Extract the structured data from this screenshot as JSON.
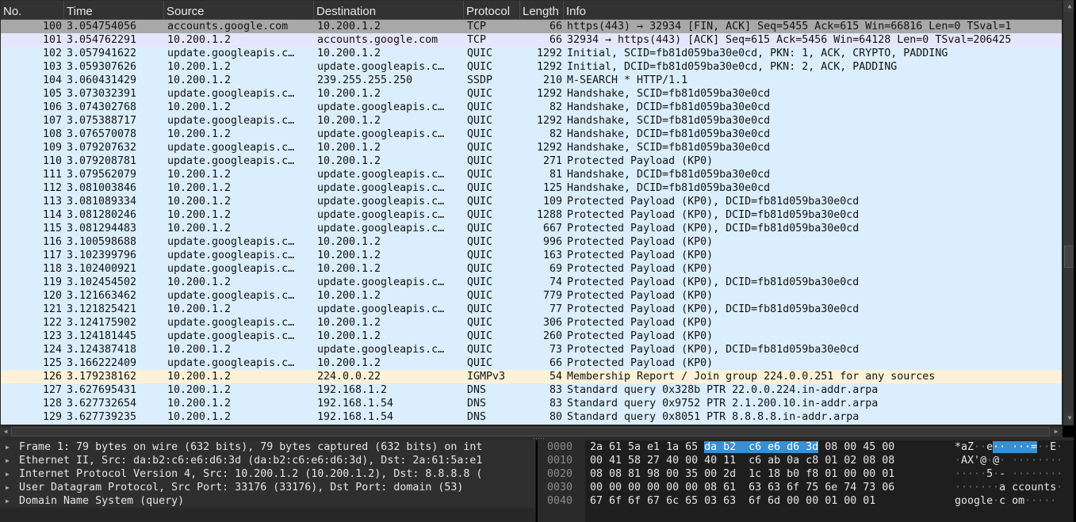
{
  "colors": {
    "row_default": "#dbeefd",
    "row_tcp_selected": "#a8a8a8",
    "row_tcp": "#e7e5fc",
    "row_igmp": "#fdf2d8",
    "header_bg": "#323232",
    "hex_highlight": "#3a8fd1"
  },
  "packet_list": {
    "columns": [
      "No.",
      "Time",
      "Source",
      "Destination",
      "Protocol",
      "Length",
      "Info"
    ],
    "rows": [
      {
        "no": "100",
        "time": "3.054754056",
        "src": "accounts.google.com",
        "dst": "10.200.1.2",
        "proto": "TCP",
        "len": "66",
        "info": "https(443) → 32934 [FIN, ACK] Seq=5455 Ack=615 Win=66816 Len=0 TSval=1",
        "style": "selected"
      },
      {
        "no": "101",
        "time": "3.054762291",
        "src": "10.200.1.2",
        "dst": "accounts.google.com",
        "proto": "TCP",
        "len": "66",
        "info": "32934 → https(443) [ACK] Seq=615 Ack=5456 Win=64128 Len=0 TSval=206425",
        "style": "tcp"
      },
      {
        "no": "102",
        "time": "3.057941622",
        "src": "update.googleapis.c…",
        "dst": "10.200.1.2",
        "proto": "QUIC",
        "len": "1292",
        "info": "Initial, SCID=fb81d059ba30e0cd, PKN: 1, ACK, CRYPTO, PADDING",
        "style": "default"
      },
      {
        "no": "103",
        "time": "3.059307626",
        "src": "10.200.1.2",
        "dst": "update.googleapis.c…",
        "proto": "QUIC",
        "len": "1292",
        "info": "Initial, DCID=fb81d059ba30e0cd, PKN: 2, ACK, PADDING",
        "style": "default"
      },
      {
        "no": "104",
        "time": "3.060431429",
        "src": "10.200.1.2",
        "dst": "239.255.255.250",
        "proto": "SSDP",
        "len": "210",
        "info": "M-SEARCH * HTTP/1.1",
        "style": "default"
      },
      {
        "no": "105",
        "time": "3.073032391",
        "src": "update.googleapis.c…",
        "dst": "10.200.1.2",
        "proto": "QUIC",
        "len": "1292",
        "info": "Handshake, SCID=fb81d059ba30e0cd",
        "style": "default"
      },
      {
        "no": "106",
        "time": "3.074302768",
        "src": "10.200.1.2",
        "dst": "update.googleapis.c…",
        "proto": "QUIC",
        "len": "82",
        "info": "Handshake, DCID=fb81d059ba30e0cd",
        "style": "default"
      },
      {
        "no": "107",
        "time": "3.075388717",
        "src": "update.googleapis.c…",
        "dst": "10.200.1.2",
        "proto": "QUIC",
        "len": "1292",
        "info": "Handshake, SCID=fb81d059ba30e0cd",
        "style": "default"
      },
      {
        "no": "108",
        "time": "3.076570078",
        "src": "10.200.1.2",
        "dst": "update.googleapis.c…",
        "proto": "QUIC",
        "len": "82",
        "info": "Handshake, DCID=fb81d059ba30e0cd",
        "style": "default"
      },
      {
        "no": "109",
        "time": "3.079207632",
        "src": "update.googleapis.c…",
        "dst": "10.200.1.2",
        "proto": "QUIC",
        "len": "1292",
        "info": "Handshake, SCID=fb81d059ba30e0cd",
        "style": "default"
      },
      {
        "no": "110",
        "time": "3.079208781",
        "src": "update.googleapis.c…",
        "dst": "10.200.1.2",
        "proto": "QUIC",
        "len": "271",
        "info": "Protected Payload (KP0)",
        "style": "default"
      },
      {
        "no": "111",
        "time": "3.079562079",
        "src": "10.200.1.2",
        "dst": "update.googleapis.c…",
        "proto": "QUIC",
        "len": "81",
        "info": "Handshake, DCID=fb81d059ba30e0cd",
        "style": "default"
      },
      {
        "no": "112",
        "time": "3.081003846",
        "src": "10.200.1.2",
        "dst": "update.googleapis.c…",
        "proto": "QUIC",
        "len": "125",
        "info": "Handshake, DCID=fb81d059ba30e0cd",
        "style": "default"
      },
      {
        "no": "113",
        "time": "3.081089334",
        "src": "10.200.1.2",
        "dst": "update.googleapis.c…",
        "proto": "QUIC",
        "len": "109",
        "info": "Protected Payload (KP0), DCID=fb81d059ba30e0cd",
        "style": "default"
      },
      {
        "no": "114",
        "time": "3.081280246",
        "src": "10.200.1.2",
        "dst": "update.googleapis.c…",
        "proto": "QUIC",
        "len": "1288",
        "info": "Protected Payload (KP0), DCID=fb81d059ba30e0cd",
        "style": "default"
      },
      {
        "no": "115",
        "time": "3.081294483",
        "src": "10.200.1.2",
        "dst": "update.googleapis.c…",
        "proto": "QUIC",
        "len": "667",
        "info": "Protected Payload (KP0), DCID=fb81d059ba30e0cd",
        "style": "default"
      },
      {
        "no": "116",
        "time": "3.100598688",
        "src": "update.googleapis.c…",
        "dst": "10.200.1.2",
        "proto": "QUIC",
        "len": "996",
        "info": "Protected Payload (KP0)",
        "style": "default"
      },
      {
        "no": "117",
        "time": "3.102399796",
        "src": "update.googleapis.c…",
        "dst": "10.200.1.2",
        "proto": "QUIC",
        "len": "163",
        "info": "Protected Payload (KP0)",
        "style": "default"
      },
      {
        "no": "118",
        "time": "3.102400921",
        "src": "update.googleapis.c…",
        "dst": "10.200.1.2",
        "proto": "QUIC",
        "len": "69",
        "info": "Protected Payload (KP0)",
        "style": "default"
      },
      {
        "no": "119",
        "time": "3.102454502",
        "src": "10.200.1.2",
        "dst": "update.googleapis.c…",
        "proto": "QUIC",
        "len": "74",
        "info": "Protected Payload (KP0), DCID=fb81d059ba30e0cd",
        "style": "default"
      },
      {
        "no": "120",
        "time": "3.121663462",
        "src": "update.googleapis.c…",
        "dst": "10.200.1.2",
        "proto": "QUIC",
        "len": "779",
        "info": "Protected Payload (KP0)",
        "style": "default"
      },
      {
        "no": "121",
        "time": "3.121825421",
        "src": "10.200.1.2",
        "dst": "update.googleapis.c…",
        "proto": "QUIC",
        "len": "77",
        "info": "Protected Payload (KP0), DCID=fb81d059ba30e0cd",
        "style": "default"
      },
      {
        "no": "122",
        "time": "3.124175902",
        "src": "update.googleapis.c…",
        "dst": "10.200.1.2",
        "proto": "QUIC",
        "len": "306",
        "info": "Protected Payload (KP0)",
        "style": "default"
      },
      {
        "no": "123",
        "time": "3.124181445",
        "src": "update.googleapis.c…",
        "dst": "10.200.1.2",
        "proto": "QUIC",
        "len": "260",
        "info": "Protected Payload (KP0)",
        "style": "default"
      },
      {
        "no": "124",
        "time": "3.124387418",
        "src": "10.200.1.2",
        "dst": "update.googleapis.c…",
        "proto": "QUIC",
        "len": "73",
        "info": "Protected Payload (KP0), DCID=fb81d059ba30e0cd",
        "style": "default"
      },
      {
        "no": "125",
        "time": "3.166222409",
        "src": "update.googleapis.c…",
        "dst": "10.200.1.2",
        "proto": "QUIC",
        "len": "66",
        "info": "Protected Payload (KP0)",
        "style": "default"
      },
      {
        "no": "126",
        "time": "3.179238162",
        "src": "10.200.1.2",
        "dst": "224.0.0.22",
        "proto": "IGMPv3",
        "len": "54",
        "info": "Membership Report / Join group 224.0.0.251 for any sources",
        "style": "igmp"
      },
      {
        "no": "127",
        "time": "3.627695431",
        "src": "10.200.1.2",
        "dst": "192.168.1.2",
        "proto": "DNS",
        "len": "83",
        "info": "Standard query 0x328b PTR 22.0.0.224.in-addr.arpa",
        "style": "default"
      },
      {
        "no": "128",
        "time": "3.627732654",
        "src": "10.200.1.2",
        "dst": "192.168.1.54",
        "proto": "DNS",
        "len": "83",
        "info": "Standard query 0x9752 PTR 2.1.200.10.in-addr.arpa",
        "style": "default"
      },
      {
        "no": "129",
        "time": "3.627739235",
        "src": "10.200.1.2",
        "dst": "192.168.1.54",
        "proto": "DNS",
        "len": "80",
        "info": "Standard query 0x8051 PTR 8.8.8.8.in-addr.arpa",
        "style": "default"
      }
    ]
  },
  "details": {
    "items": [
      {
        "label": "Frame 1: 79 bytes on wire (632 bits), 79 bytes captured (632 bits) on int",
        "icon": "expand-arrow-icon"
      },
      {
        "label": "Ethernet II, Src: da:b2:c6:e6:d6:3d (da:b2:c6:e6:d6:3d), Dst: 2a:61:5a:e1",
        "icon": "expand-arrow-icon"
      },
      {
        "label": "Internet Protocol Version 4, Src: 10.200.1.2 (10.200.1.2), Dst: 8.8.8.8 (",
        "icon": "expand-arrow-icon"
      },
      {
        "label": "User Datagram Protocol, Src Port: 33176 (33176), Dst Port: domain (53)",
        "icon": "expand-arrow-icon"
      },
      {
        "label": "Domain Name System (query)",
        "icon": "expand-arrow-icon"
      }
    ]
  },
  "hex": {
    "rows": [
      {
        "offset": "0000",
        "pre": "2a 61 5a e1 1a 65 ",
        "hl": "da b2  c6 e6 d6 3d",
        "post": " 08 00 45 00",
        "ascii_pre": "*aZ··e",
        "ascii_hl": "·· ···=",
        "ascii_post": "··E·"
      },
      {
        "offset": "0010",
        "pre": "00 41 58 27 40 00 40 11  c6 ab 0a c8 01 02 08 08",
        "hl": "",
        "post": "",
        "ascii_pre": "·AX'@·@· ········",
        "ascii_hl": "",
        "ascii_post": ""
      },
      {
        "offset": "0020",
        "pre": "08 08 81 98 00 35 00 2d  1c 18 b0 f8 01 00 00 01",
        "hl": "",
        "post": "",
        "ascii_pre": "·····5·- ········",
        "ascii_hl": "",
        "ascii_post": ""
      },
      {
        "offset": "0030",
        "pre": "00 00 00 00 00 00 08 61  63 63 6f 75 6e 74 73 06",
        "hl": "",
        "post": "",
        "ascii_pre": "·······a ccounts·",
        "ascii_hl": "",
        "ascii_post": ""
      },
      {
        "offset": "0040",
        "pre": "67 6f 6f 67 6c 65 03 63  6f 6d 00 00 01 00 01",
        "hl": "",
        "post": "",
        "ascii_pre": "google·c om·····",
        "ascii_hl": "",
        "ascii_post": ""
      }
    ]
  },
  "icons": {
    "scroll_up": "▲",
    "scroll_down": "▼",
    "scroll_left": "◀",
    "scroll_right": "▶",
    "expand": "▶"
  }
}
